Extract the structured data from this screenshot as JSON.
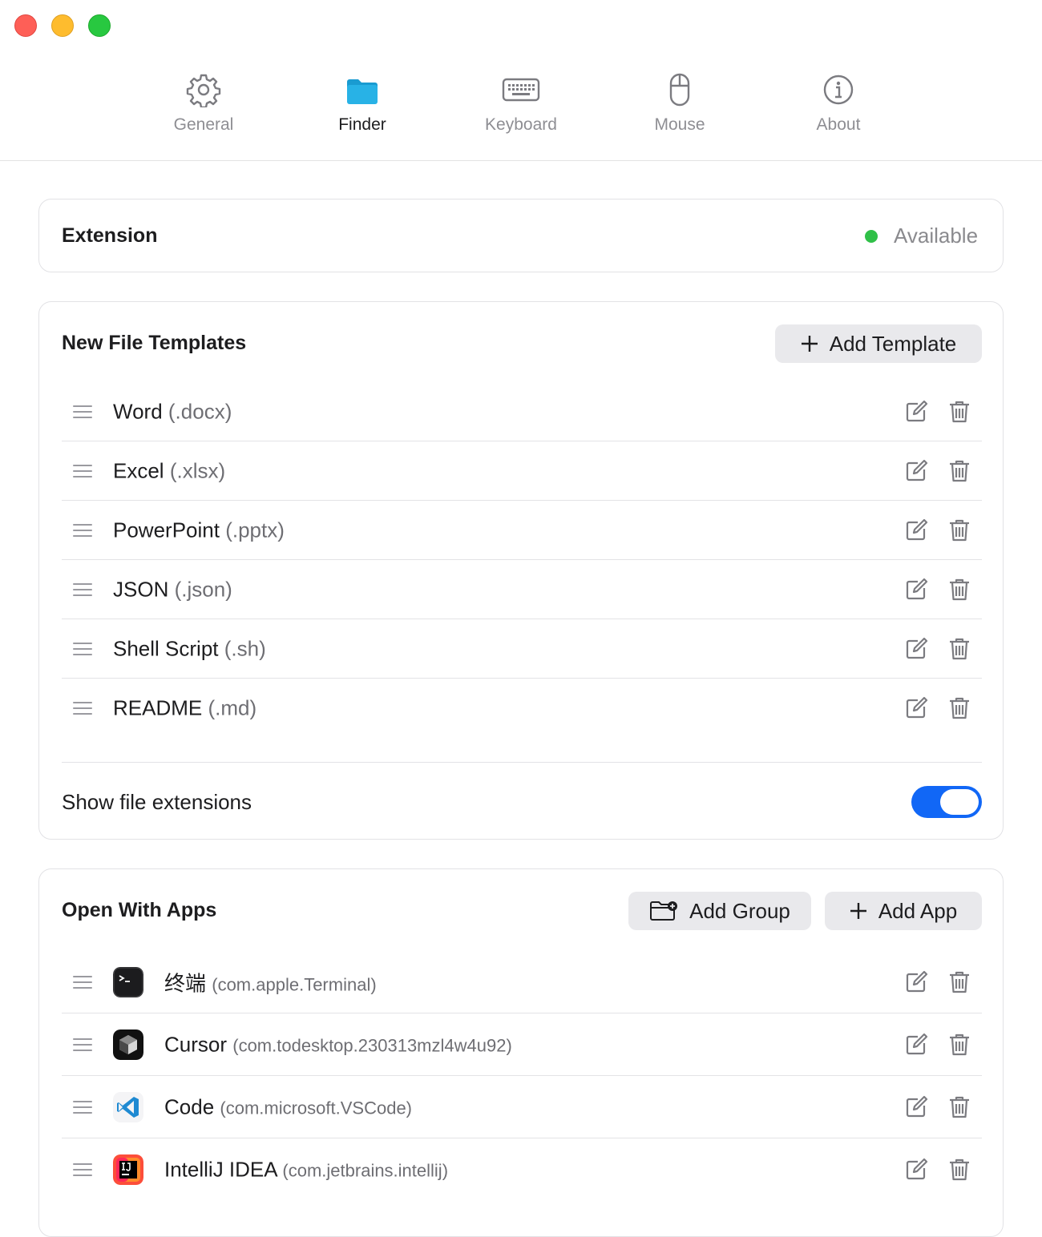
{
  "window": {
    "traffic_lights": [
      "close",
      "minimize",
      "zoom"
    ]
  },
  "tabs": [
    {
      "label": "General",
      "icon": "gear-icon"
    },
    {
      "label": "Finder",
      "icon": "folder-icon",
      "active": true
    },
    {
      "label": "Keyboard",
      "icon": "keyboard-icon"
    },
    {
      "label": "Mouse",
      "icon": "mouse-icon"
    },
    {
      "label": "About",
      "icon": "info-icon"
    }
  ],
  "extension": {
    "title": "Extension",
    "status": "Available",
    "status_color": "#30c048"
  },
  "templates": {
    "title": "New File Templates",
    "add_button": "Add Template",
    "items": [
      {
        "name": "Word",
        "ext": "(.docx)"
      },
      {
        "name": "Excel",
        "ext": "(.xlsx)"
      },
      {
        "name": "PowerPoint",
        "ext": "(.pptx)"
      },
      {
        "name": "JSON",
        "ext": "(.json)"
      },
      {
        "name": "Shell Script",
        "ext": "(.sh)"
      },
      {
        "name": "README",
        "ext": "(.md)"
      }
    ],
    "show_extensions_label": "Show file extensions",
    "show_extensions_on": true,
    "toggle_color": "#1167f6"
  },
  "open_with": {
    "title": "Open With Apps",
    "add_group_button": "Add Group",
    "add_app_button": "Add App",
    "items": [
      {
        "name": "终端",
        "bundle": "(com.apple.Terminal)",
        "icon": "terminal-icon"
      },
      {
        "name": "Cursor",
        "bundle": "(com.todesktop.230313mzl4w4u92)",
        "icon": "cursor-app-icon"
      },
      {
        "name": "Code",
        "bundle": "(com.microsoft.VSCode)",
        "icon": "vscode-icon"
      },
      {
        "name": "IntelliJ IDEA",
        "bundle": "(com.jetbrains.intellij)",
        "icon": "intellij-icon"
      }
    ]
  }
}
